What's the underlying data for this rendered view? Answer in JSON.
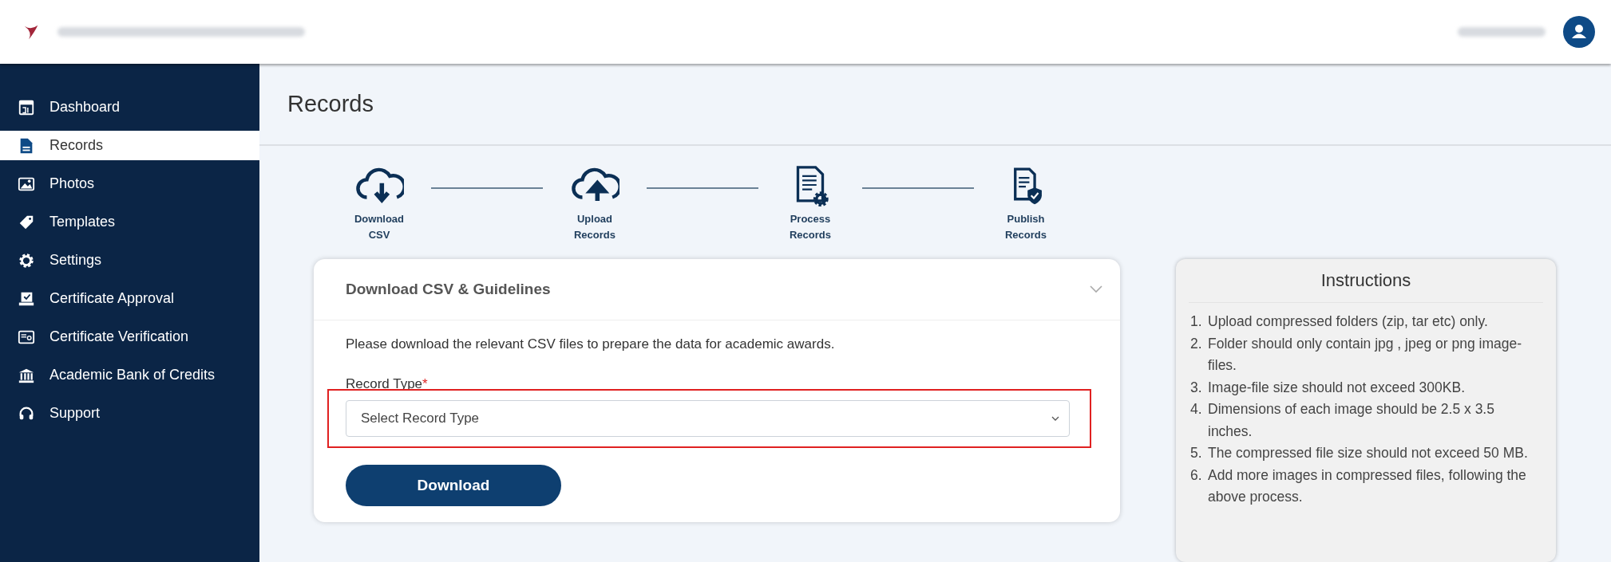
{
  "sidebar": {
    "items": [
      {
        "label": "Dashboard",
        "selected": false
      },
      {
        "label": "Records",
        "selected": true
      },
      {
        "label": "Photos",
        "selected": false
      },
      {
        "label": "Templates",
        "selected": false
      },
      {
        "label": "Settings",
        "selected": false
      },
      {
        "label": "Certificate Approval",
        "selected": false
      },
      {
        "label": "Certificate Verification",
        "selected": false
      },
      {
        "label": "Academic Bank of Credits",
        "selected": false
      },
      {
        "label": "Support",
        "selected": false
      }
    ]
  },
  "page": {
    "title": "Records"
  },
  "steps": [
    {
      "label": "Download\nCSV"
    },
    {
      "label": "Upload\nRecords"
    },
    {
      "label": "Process\nRecords"
    },
    {
      "label": "Publish\nRecords"
    }
  ],
  "card": {
    "title": "Download CSV & Guidelines",
    "description": "Please download the relevant CSV files to prepare the data for academic awards.",
    "field_label": "Record Type",
    "required_mark": "*",
    "select_placeholder": "Select Record Type",
    "highlighted": true,
    "button": "Download"
  },
  "instructions": {
    "title": "Instructions",
    "items": [
      {
        "number": "1.",
        "text": "Upload compressed folders (zip, tar etc) only."
      },
      {
        "number": "2.",
        "text": "Folder should only contain jpg , jpeg or png image-files."
      },
      {
        "number": "3.",
        "text": "Image-file size should not exceed 300KB."
      },
      {
        "number": "4.",
        "text": "Dimensions of each image should be 2.5 x 3.5 inches."
      },
      {
        "number": "5.",
        "text": "The compressed file size should not exceed 50 MB."
      },
      {
        "number": "6.",
        "text": "Add more images in compressed files, following the above process."
      }
    ]
  }
}
